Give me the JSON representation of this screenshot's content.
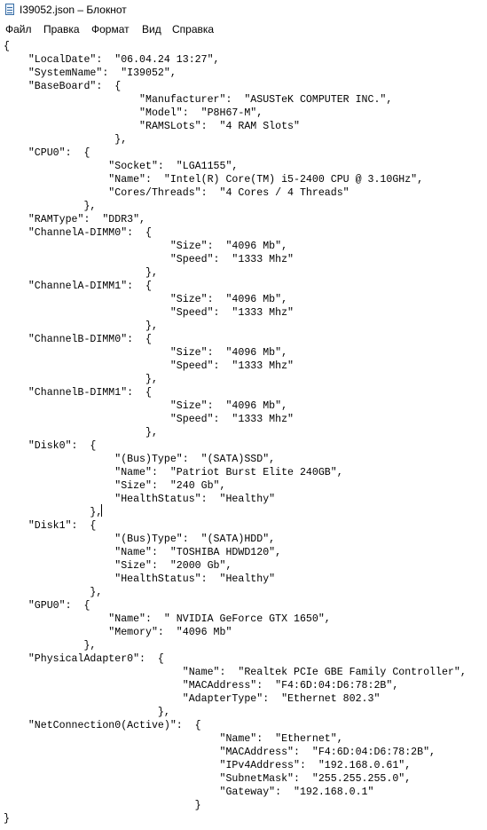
{
  "window": {
    "title": "I39052.json – Блокнот"
  },
  "menu": {
    "items": [
      {
        "label": "Файл"
      },
      {
        "label": "Правка"
      },
      {
        "label": "Формат"
      },
      {
        "label": "Вид"
      },
      {
        "label": "Справка"
      }
    ]
  },
  "editor": {
    "lines": [
      "{",
      "    \"LocalDate\":  \"06.04.24 13:27\",",
      "    \"SystemName\":  \"I39052\",",
      "    \"BaseBoard\":  {",
      "                      \"Manufacturer\":  \"ASUSTeK COMPUTER INC.\",",
      "                      \"Model\":  \"P8H67-M\",",
      "                      \"RAMSLots\":  \"4 RAM Slots\"",
      "                  },",
      "    \"CPU0\":  {",
      "                 \"Socket\":  \"LGA1155\",",
      "                 \"Name\":  \"Intel(R) Core(TM) i5-2400 CPU @ 3.10GHz\",",
      "                 \"Cores/Threads\":  \"4 Cores / 4 Threads\"",
      "             },",
      "    \"RAMType\":  \"DDR3\",",
      "    \"ChannelA-DIMM0\":  {",
      "                           \"Size\":  \"4096 Mb\",",
      "                           \"Speed\":  \"1333 Mhz\"",
      "                       },",
      "    \"ChannelA-DIMM1\":  {",
      "                           \"Size\":  \"4096 Mb\",",
      "                           \"Speed\":  \"1333 Mhz\"",
      "                       },",
      "    \"ChannelB-DIMM0\":  {",
      "                           \"Size\":  \"4096 Mb\",",
      "                           \"Speed\":  \"1333 Mhz\"",
      "                       },",
      "    \"ChannelB-DIMM1\":  {",
      "                           \"Size\":  \"4096 Mb\",",
      "                           \"Speed\":  \"1333 Mhz\"",
      "                       },",
      "    \"Disk0\":  {",
      "                  \"(Bus)Type\":  \"(SATA)SSD\",",
      "                  \"Name\":  \"Patriot Burst Elite 240GB\",",
      "                  \"Size\":  \"240 Gb\",",
      "                  \"HealthStatus\":  \"Healthy\"",
      "              },",
      "    \"Disk1\":  {",
      "                  \"(Bus)Type\":  \"(SATA)HDD\",",
      "                  \"Name\":  \"TOSHIBA HDWD120\",",
      "                  \"Size\":  \"2000 Gb\",",
      "                  \"HealthStatus\":  \"Healthy\"",
      "              },",
      "    \"GPU0\":  {",
      "                 \"Name\":  \" NVIDIA GeForce GTX 1650\",",
      "                 \"Memory\":  \"4096 Mb\"",
      "             },",
      "    \"PhysicalAdapter0\":  {",
      "                             \"Name\":  \"Realtek PCIe GBE Family Controller\",",
      "                             \"MACAddress\":  \"F4:6D:04:D6:78:2B\",",
      "                             \"AdapterType\":  \"Ethernet 802.3\"",
      "                         },",
      "    \"NetConnection0(Active)\":  {",
      "                                   \"Name\":  \"Ethernet\",",
      "                                   \"MACAddress\":  \"F4:6D:04:D6:78:2B\",",
      "                                   \"IPv4Address\":  \"192.168.0.61\",",
      "                                   \"SubnetMask\":  \"255.255.255.0\",",
      "                                   \"Gateway\":  \"192.168.0.1\"",
      "                               }",
      "}"
    ]
  }
}
